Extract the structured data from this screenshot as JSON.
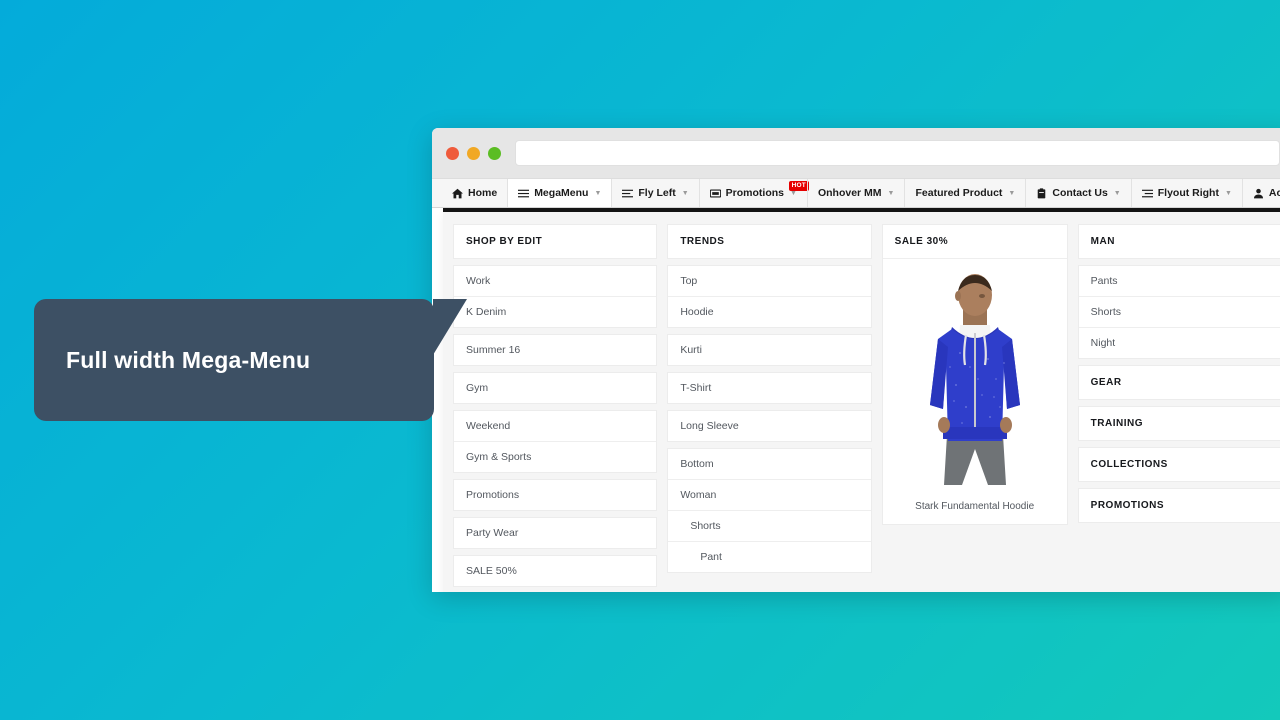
{
  "callout": {
    "text": "Full width Mega-Menu",
    "bg_color": "#3d5064"
  },
  "background": {
    "from": "#04ABDA",
    "to": "#13C9BB"
  },
  "browser": {
    "traffic_lights": [
      "red",
      "yellow",
      "green"
    ],
    "url_value": "",
    "url_placeholder": ""
  },
  "nav": {
    "items": [
      {
        "label": "Home",
        "icon": "home-icon",
        "caret": false,
        "badge": null,
        "active": false
      },
      {
        "label": "MegaMenu",
        "icon": "hamburger-icon",
        "caret": true,
        "badge": null,
        "active": true
      },
      {
        "label": "Fly Left",
        "icon": "list-left-icon",
        "caret": true,
        "badge": null,
        "active": false
      },
      {
        "label": "Promotions",
        "icon": "image-icon",
        "caret": true,
        "badge": "HOT",
        "active": false
      },
      {
        "label": "Onhover MM",
        "icon": null,
        "caret": true,
        "badge": null,
        "active": false
      },
      {
        "label": "Featured Product",
        "icon": null,
        "caret": true,
        "badge": null,
        "active": false
      },
      {
        "label": "Contact Us",
        "icon": "clipboard-icon",
        "caret": true,
        "badge": null,
        "active": false
      },
      {
        "label": "Flyout Right",
        "icon": "list-right-icon",
        "caret": true,
        "badge": null,
        "active": false
      },
      {
        "label": "Account",
        "icon": "user-icon",
        "caret": true,
        "badge": null,
        "active": false
      }
    ],
    "badge_color": "#e60000",
    "caret_glyph": "▼"
  },
  "mega": {
    "columns": [
      {
        "type": "list",
        "header": "SHOP BY EDIT",
        "groups": [
          {
            "items": [
              {
                "label": "Work",
                "indent": 0
              },
              {
                "label": "K Denim",
                "indent": 0
              }
            ]
          },
          {
            "items": [
              {
                "label": "Summer 16",
                "indent": 0
              }
            ]
          },
          {
            "items": [
              {
                "label": "Gym",
                "indent": 0
              }
            ]
          },
          {
            "items": [
              {
                "label": "Weekend",
                "indent": 0
              },
              {
                "label": "Gym & Sports",
                "indent": 0
              }
            ]
          },
          {
            "items": [
              {
                "label": "Promotions",
                "indent": 0
              }
            ]
          },
          {
            "items": [
              {
                "label": "Party Wear",
                "indent": 0
              }
            ]
          },
          {
            "items": [
              {
                "label": "SALE 50%",
                "indent": 0
              }
            ]
          }
        ]
      },
      {
        "type": "list",
        "header": "TRENDS",
        "groups": [
          {
            "items": [
              {
                "label": "Top",
                "indent": 0
              },
              {
                "label": "Hoodie",
                "indent": 0
              }
            ]
          },
          {
            "items": [
              {
                "label": "Kurti",
                "indent": 0
              }
            ]
          },
          {
            "items": [
              {
                "label": "T-Shirt",
                "indent": 0
              }
            ]
          },
          {
            "items": [
              {
                "label": "Long Sleeve",
                "indent": 0
              }
            ]
          },
          {
            "items": [
              {
                "label": "Bottom",
                "indent": 0
              },
              {
                "label": "Woman",
                "indent": 0
              },
              {
                "label": "Shorts",
                "indent": 1
              },
              {
                "label": "Pant",
                "indent": 2
              }
            ]
          }
        ]
      },
      {
        "type": "product",
        "header": "SALE 30%",
        "product_name": "Stark Fundamental Hoodie",
        "product_image": "man-in-blue-hoodie-photo"
      },
      {
        "type": "list",
        "header": "MAN",
        "groups": [
          {
            "items": [
              {
                "label": "Pants",
                "indent": 0
              },
              {
                "label": "Shorts",
                "indent": 0
              },
              {
                "label": "Night",
                "indent": 0
              }
            ]
          }
        ],
        "extra_headers": [
          "GEAR",
          "TRAINING",
          "COLLECTIONS",
          "PROMOTIONS"
        ]
      }
    ]
  }
}
